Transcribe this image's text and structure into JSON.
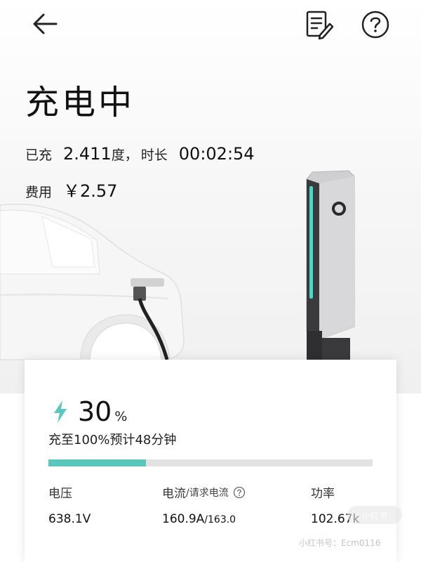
{
  "header": {
    "back_icon": "back-arrow-icon",
    "record_icon": "edit-record-icon",
    "help_icon": "help-circle-icon"
  },
  "status": {
    "title": "充电中",
    "charged_label": "已充",
    "charged_value": "2.411",
    "charged_unit": "度",
    "separator": "，",
    "duration_label": "时长",
    "duration_value": "00:02:54",
    "cost_label": "费用",
    "cost_value": "￥2.57"
  },
  "card": {
    "percent_value": "30",
    "percent_unit": "%",
    "eta_text": "充至100%预计48分钟",
    "progress": 0.3,
    "voltage_label": "电压",
    "voltage_value": "638.1V",
    "current_label": "电流",
    "current_request_label": "/请求电流",
    "current_value": "160.9A",
    "current_request_value": "/163.0",
    "power_label": "功率",
    "power_value": "102.67k"
  },
  "watermark": {
    "text": "小红书号：Ecm0116",
    "badge": "小红书"
  },
  "colors": {
    "accent": "#5bc6be",
    "progress_track": "#e2e2e2",
    "charger_led": "#46d8c8"
  }
}
